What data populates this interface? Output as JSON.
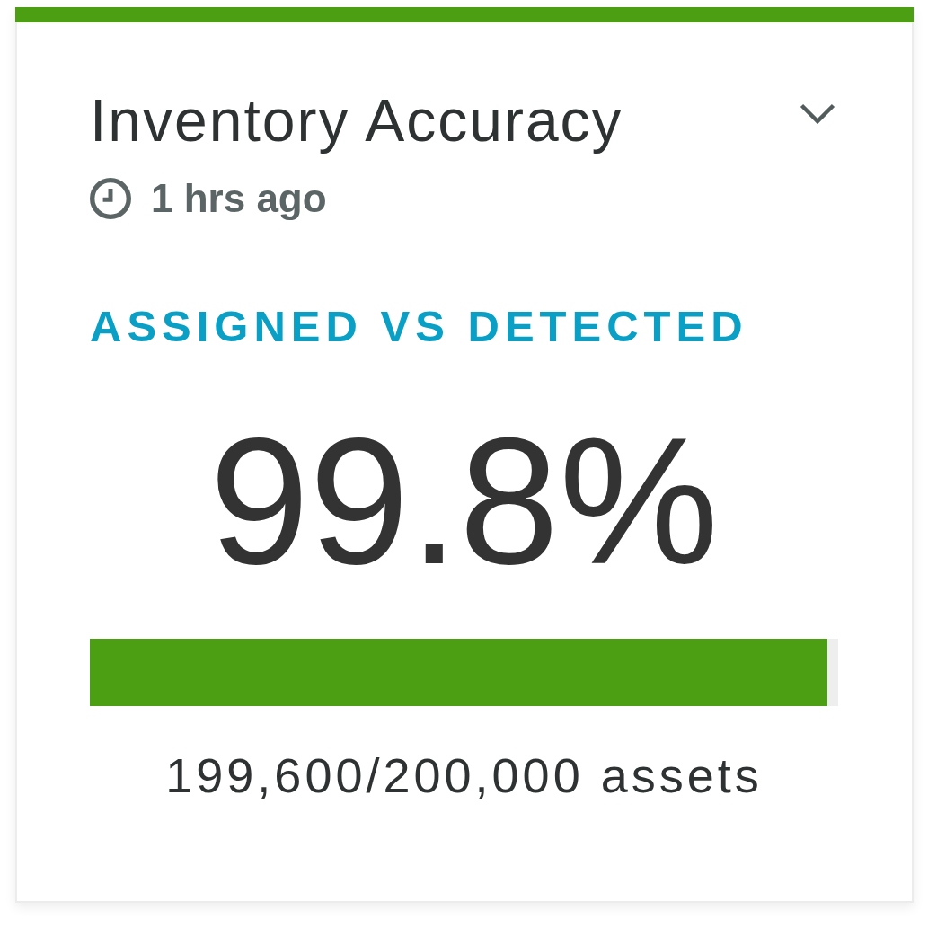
{
  "card": {
    "title": "Inventory Accuracy",
    "updated": "1 hrs ago"
  },
  "metric": {
    "label": "ASSIGNED VS DETECTED",
    "value": "99.8%",
    "level": 0.985,
    "detail": "199,600/200,000 assets"
  }
}
